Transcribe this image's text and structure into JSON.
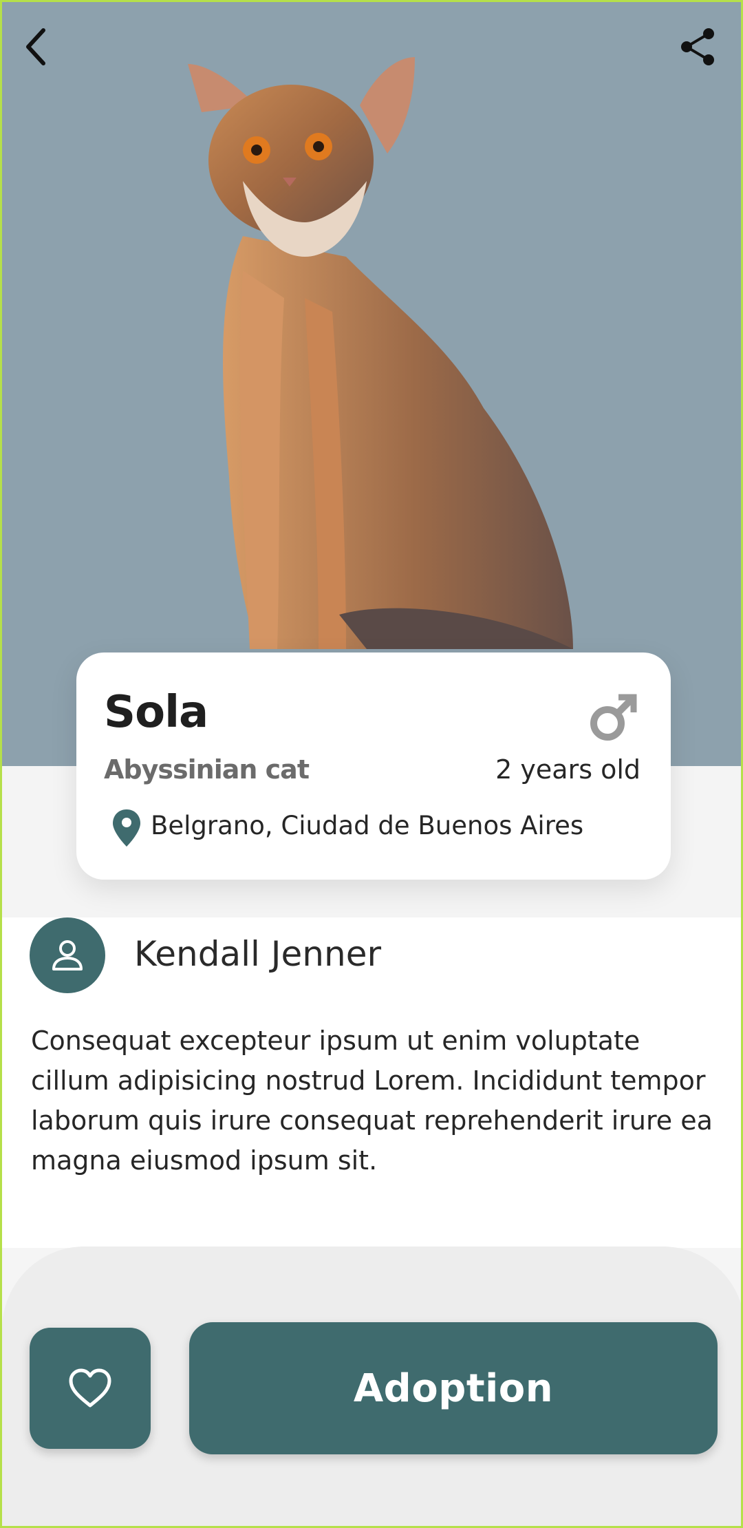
{
  "colors": {
    "hero_background": "#8da1ad",
    "accent": "#3f6b6e",
    "card_background": "#ffffff",
    "bottom_bar": "#ededed"
  },
  "header": {
    "back_icon": "chevron-left-icon",
    "share_icon": "share-icon"
  },
  "hero": {
    "image": "abyssinian-cat-photo"
  },
  "pet": {
    "name": "Sola",
    "breed": "Abyssinian cat",
    "age": "2 years old",
    "gender_icon": "male-icon",
    "location_icon": "map-pin-icon",
    "location": "Belgrano, Ciudad de Buenos Aires"
  },
  "owner": {
    "avatar_icon": "person-icon",
    "name": "Kendall Jenner"
  },
  "description": "Consequat excepteur ipsum ut enim voluptate cillum adipisicing nostrud Lorem. Incididunt tempor laborum quis irure consequat reprehenderit irure ea magna eiusmod ipsum sit.",
  "actions": {
    "favorite_icon": "heart-icon",
    "adopt_label": "Adoption"
  }
}
